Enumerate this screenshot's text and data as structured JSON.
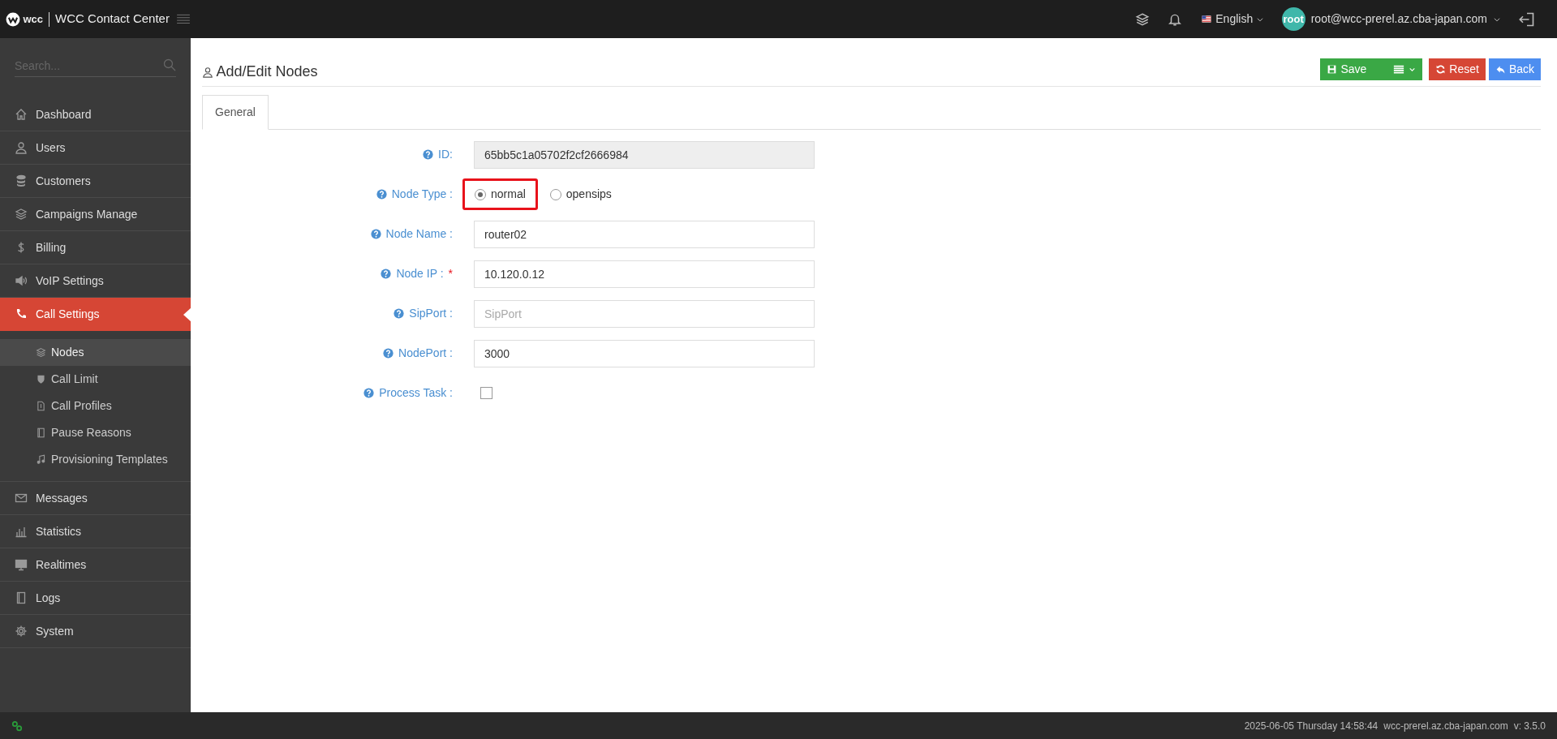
{
  "header": {
    "logo_text": "wcc",
    "app_title": "WCC Contact Center",
    "language": "English",
    "avatar_text": "root",
    "user_email": "root@wcc-prerel.az.cba-japan.com"
  },
  "sidebar": {
    "search": {
      "placeholder": "Search..."
    },
    "items": [
      {
        "label": "Dashboard",
        "selected": false
      },
      {
        "label": "Users",
        "selected": false
      },
      {
        "label": "Customers",
        "selected": false
      },
      {
        "label": "Campaigns Manage",
        "selected": false
      },
      {
        "label": "Billing",
        "selected": false
      },
      {
        "label": "VoIP Settings",
        "selected": false
      },
      {
        "label": "Call Settings",
        "selected": true,
        "expanded": true,
        "children": [
          {
            "label": "Nodes",
            "selected": true
          },
          {
            "label": "Call Limit",
            "selected": false
          },
          {
            "label": "Call Profiles",
            "selected": false
          },
          {
            "label": "Pause Reasons",
            "selected": false
          },
          {
            "label": "Provisioning Templates",
            "selected": false
          }
        ]
      },
      {
        "label": "Messages",
        "selected": false
      },
      {
        "label": "Statistics",
        "selected": false
      },
      {
        "label": "Realtimes",
        "selected": false
      },
      {
        "label": "Logs",
        "selected": false
      },
      {
        "label": "System",
        "selected": false
      }
    ]
  },
  "page": {
    "title": "Add/Edit Nodes",
    "buttons": [
      {
        "kind": "save",
        "label": "Save"
      },
      {
        "kind": "menu"
      },
      {
        "kind": "reset",
        "label": "Reset"
      },
      {
        "kind": "back",
        "label": "Back"
      }
    ]
  },
  "tabs": [
    {
      "label": "General",
      "selected": true
    }
  ],
  "form": [
    {
      "kind": "text",
      "label": "ID:",
      "value": "65bb5c1a05702f2cf2666984",
      "disabled": true
    },
    {
      "kind": "radio",
      "label": "Node Type :",
      "options": [
        {
          "label": "normal",
          "selected": true,
          "highlighted": true
        },
        {
          "label": "opensips",
          "selected": false,
          "highlighted": false
        }
      ]
    },
    {
      "kind": "text",
      "label": "Node Name :",
      "value": "router02",
      "disabled": false
    },
    {
      "kind": "text",
      "label": "Node IP :",
      "value": "10.120.0.12",
      "disabled": false,
      "required_mark": "*"
    },
    {
      "kind": "text",
      "label": "SipPort :",
      "placeholder": "SipPort",
      "disabled": false
    },
    {
      "kind": "text",
      "label": "NodePort :",
      "value": "3000",
      "disabled": false
    },
    {
      "kind": "checkbox",
      "label": "Process Task :",
      "checked": false
    }
  ],
  "footer": {
    "datetime": "2025-06-05 Thursday 14:58:44",
    "host": "wcc-prerel.az.cba-japan.com",
    "version": "v: 3.5.0"
  }
}
